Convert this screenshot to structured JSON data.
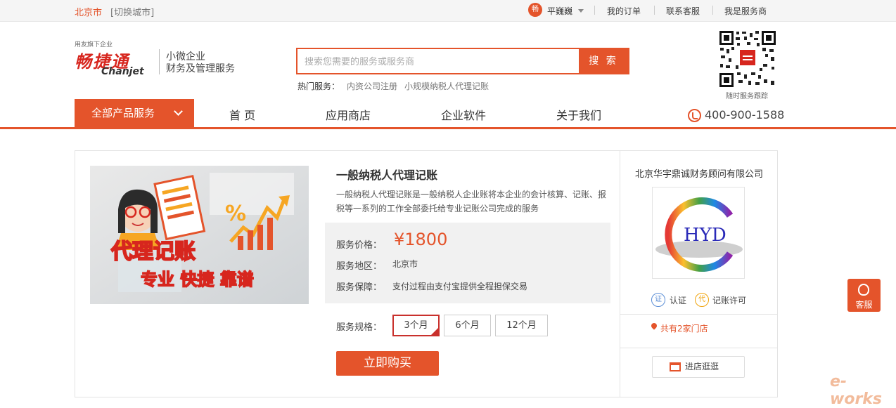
{
  "topbar": {
    "city": "北京市",
    "switch_city": "[切换城市]",
    "user_avatar": "畅",
    "user_name": "平巍巍",
    "links": [
      "我的订单",
      "联系客服",
      "我是服务商"
    ]
  },
  "header": {
    "logo_tag": "用友旗下企业",
    "logo_brand": "畅捷通",
    "logo_en": "Chanjet",
    "slogan_line1": "小微企业",
    "slogan_line2": "财务及管理服务",
    "search_placeholder": "搜索您需要的服务或服务商",
    "search_button": "搜 索",
    "hot_label": "热门服务：",
    "hot_links": [
      "内资公司注册",
      "小规模纳税人代理记账"
    ],
    "qr_label": "随时服务跟踪"
  },
  "nav": {
    "all_products": "全部产品服务",
    "items": [
      "首 页",
      "应用商店",
      "企业软件",
      "关于我们"
    ],
    "phone": "400-900-1588"
  },
  "product": {
    "image_text_line1": "代理记账",
    "image_text_line2": "专业 快捷 靠谱",
    "title": "一般纳税人代理记账",
    "description": "一般纳税人代理记账是一般纳税人企业账将本企业的会计核算、记账、报税等一系列的工作全部委托给专业记账公司完成的服务",
    "price_label": "服务价格：",
    "price": "¥1800",
    "region_label": "服务地区：",
    "region": "北京市",
    "guarantee_label": "服务保障：",
    "guarantee": "支付过程由支付宝提供全程担保交易",
    "spec_label": "服务规格：",
    "specs": [
      "3个月",
      "6个月",
      "12个月"
    ],
    "selected_spec": "3个月",
    "buy_button": "立即购买"
  },
  "provider": {
    "company": "北京华宇鼎诚财务顾问有限公司",
    "logo_text": "HYD",
    "badge1_icon": "证",
    "badge1": "认证",
    "badge2_icon": "代",
    "badge2": "记账许可",
    "stores": "共有2家门店",
    "visit_button": "进店逛逛"
  },
  "float": {
    "kefu": "客服"
  },
  "watermark": "e-works",
  "colors": {
    "accent": "#e4542b",
    "price_box": "#f1f1f1"
  }
}
